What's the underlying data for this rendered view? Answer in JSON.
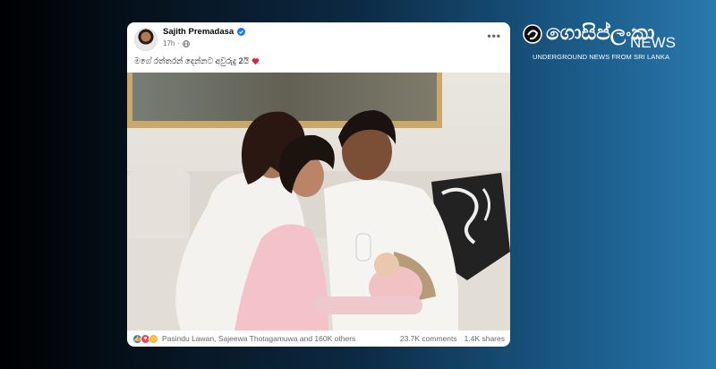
{
  "post": {
    "author": "Sajith Premadasa",
    "time": "17h",
    "caption": "මගේ රත්තරන් දෙන්නට අවුරුදු 2යි",
    "reactors": "Pasindu Lawan, Sajeewa Thotagamuwa and 160K others",
    "comments": "23.7K comments",
    "shares": "1.4K shares",
    "icons": [
      "verified-icon",
      "globe-icon",
      "more-icon",
      "heart-icon",
      "like-reaction-icon",
      "love-reaction-icon",
      "care-reaction-icon"
    ]
  },
  "logo": {
    "title": "ගොසිප්ලංකා",
    "news": "NEWS",
    "subtitle": "UNDERGROUND NEWS FROM SRI LANKA"
  },
  "colors": {
    "facebook_blue": "#1877f2",
    "love_red": "#f33e58",
    "care_yellow": "#f7b928"
  }
}
